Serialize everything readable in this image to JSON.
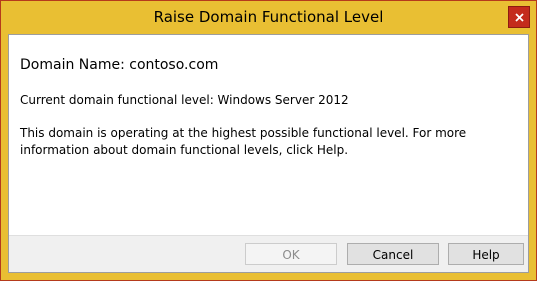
{
  "window": {
    "title": "Raise Domain Functional Level",
    "close_label": "x"
  },
  "content": {
    "domain_name": "Domain Name: contoso.com",
    "current_level": "Current domain functional level: Windows Server 2012",
    "info_text": "This domain is operating at the highest possible functional level. For more information about domain functional levels, click Help."
  },
  "buttons": {
    "ok_label": "OK",
    "ok_enabled": false,
    "cancel_label": "Cancel",
    "help_label": "Help"
  },
  "colors": {
    "title_bar": "#e9bf33",
    "close_button": "#c42b1c",
    "footer": "#f0f0f0"
  },
  "icons": {
    "close": "close-icon"
  }
}
